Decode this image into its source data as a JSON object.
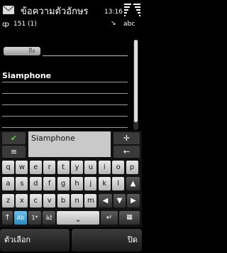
{
  "status": {
    "title": "ข้อความตัวอักษร",
    "time": "13:16",
    "antenna": "ȹ",
    "counter": "151 (1)",
    "input_mode": "abc"
  },
  "message": {
    "to_label": "ถึง",
    "body": "Siamphone"
  },
  "keyboard": {
    "prediction": "Siamphone",
    "row1": [
      "q",
      "w",
      "e",
      "r",
      "t",
      "y",
      "u",
      "i",
      "o",
      "p"
    ],
    "row2": [
      "a",
      "s",
      "d",
      "f",
      "g",
      "h",
      "j",
      "k",
      "l"
    ],
    "row3": [
      "z",
      "x",
      "c",
      "v",
      "b",
      "n",
      "m"
    ],
    "shift_key": "Ab",
    "number_key": "1*",
    "lang_key": "àž",
    "menu_key": "≡",
    "move_key": "✛",
    "accept_key": "✔"
  },
  "softkeys": {
    "left": "ตัวเลือก",
    "right": "ปิด"
  }
}
